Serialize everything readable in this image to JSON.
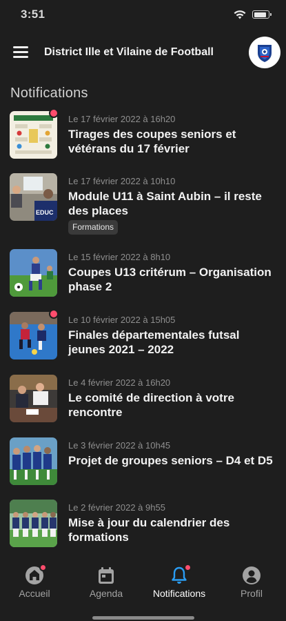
{
  "status_bar": {
    "time": "3:51",
    "battery_level": 0.85
  },
  "header": {
    "title": "District Ille et Vilaine de Football"
  },
  "section": {
    "title": "Notifications"
  },
  "notifications": [
    {
      "date": "Le 17 février 2022 à 16h20",
      "title": "Tirages des coupes seniors et vétérans du 17 février",
      "unread": true,
      "thumbnail": "draw-chart-image"
    },
    {
      "date": "Le 17 février 2022 à 10h10",
      "title": "Module U11 à Saint Aubin – il reste des places",
      "unread": false,
      "tag": "Formations",
      "thumbnail": "classroom-image"
    },
    {
      "date": "Le 15 février 2022 à 8h10",
      "title": "Coupes U13 critérum – Organisation phase 2",
      "unread": false,
      "thumbnail": "youth-football-image"
    },
    {
      "date": "Le 10 février 2022 à 15h05",
      "title": "Finales départementales futsal jeunes 2021 – 2022",
      "unread": true,
      "thumbnail": "futsal-image"
    },
    {
      "date": "Le 4 février 2022 à 16h20",
      "title": "Le comité de direction à votre rencontre",
      "unread": false,
      "thumbnail": "meeting-image"
    },
    {
      "date": "Le 3 février 2022 à 10h45",
      "title": "Projet de groupes seniors – D4 et D5",
      "unread": false,
      "thumbnail": "team-huddle-image"
    },
    {
      "date": "Le 2 février 2022 à 9h55",
      "title": "Mise à jour du calendrier des formations",
      "unread": false,
      "thumbnail": "team-photo-image"
    }
  ],
  "tabs": [
    {
      "label": "Accueil",
      "icon": "home-icon",
      "badge": true,
      "active": false
    },
    {
      "label": "Agenda",
      "icon": "calendar-icon",
      "badge": false,
      "active": false
    },
    {
      "label": "Notifications",
      "icon": "bell-icon",
      "badge": true,
      "active": true
    },
    {
      "label": "Profil",
      "icon": "profile-icon",
      "badge": false,
      "active": false
    }
  ],
  "colors": {
    "background": "#1e1e1e",
    "accent": "#2a9df4",
    "badge": "#ff4d6d",
    "muted_text": "#8f8f8f"
  }
}
